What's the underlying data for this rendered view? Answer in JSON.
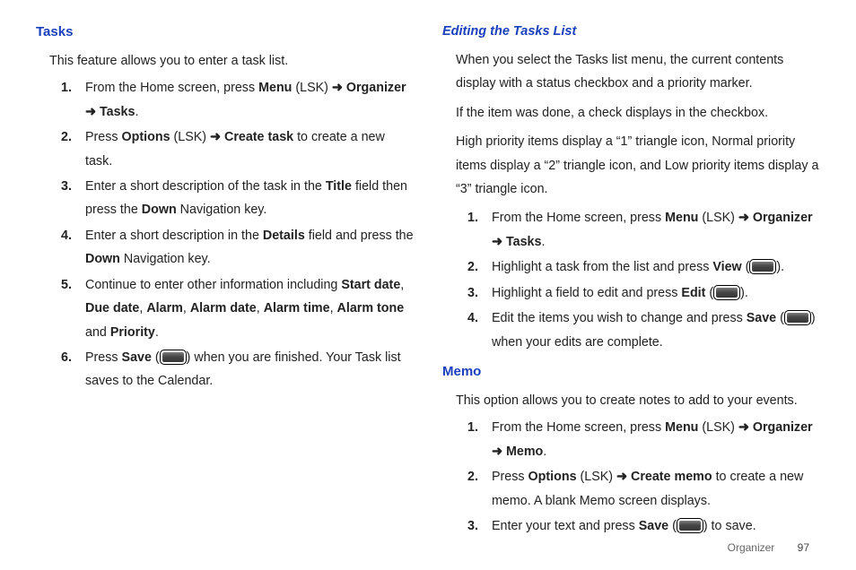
{
  "left": {
    "tasks_heading": "Tasks",
    "tasks_intro": "This feature allows you to enter a task list.",
    "step1_a": "From the Home screen, press ",
    "step1_menu": "Menu",
    "step1_b": " (LSK) ",
    "arrow": "➜",
    "step1_org": " Organizer ",
    "step1_tasks": " Tasks",
    "period": ".",
    "step2_a": "Press ",
    "step2_options": "Options",
    "step2_b": " (LSK) ",
    "step2_create": " Create task",
    "step2_c": " to create a new task.",
    "step3_a": "Enter a short description of the task in the ",
    "step3_title": "Title",
    "step3_b": " field then press the ",
    "step3_down": "Down",
    "step3_c": " Navigation key.",
    "step4_a": "Enter a short description in the ",
    "step4_details": "Details",
    "step4_b": " field and press the ",
    "step4_down": "Down",
    "step4_c": " Navigation key.",
    "step5_a": "Continue to enter other information including ",
    "step5_start": "Start date",
    "step5_sep1": ", ",
    "step5_due": "Due date",
    "step5_sep2": ", ",
    "step5_alarm": "Alarm",
    "step5_sep3": ", ",
    "step5_alarmdate": "Alarm date",
    "step5_sep4": ", ",
    "step5_alarmtime": "Alarm time",
    "step5_sep5": ", ",
    "step5_alarmtone": "Alarm tone",
    "step5_sep6": " and ",
    "step5_priority": "Priority",
    "step6_a": "Press ",
    "step6_save": "Save",
    "step6_b": " (",
    "step6_c": ") when you are finished. Your Task list saves to the Calendar."
  },
  "right": {
    "edit_heading": "Editing the Tasks List",
    "p1": "When you select the Tasks list menu, the current contents display with a status checkbox and a priority marker.",
    "p2": "If the item was done, a check displays in the checkbox.",
    "p3": "High priority items display a “1” triangle icon, Normal priority items display a “2” triangle icon, and Low priority items display a “3” triangle icon.",
    "e1_a": "From the Home screen, press ",
    "e1_menu": "Menu",
    "e1_b": " (LSK) ",
    "e1_org": " Organizer ",
    "e1_tasks": " Tasks",
    "e2_a": "Highlight a task from the list and press ",
    "e2_view": "View",
    "e2_b": " (",
    "e2_c": ").",
    "e3_a": "Highlight a field to edit and press ",
    "e3_edit": "Edit",
    "e3_b": " (",
    "e3_c": ").",
    "e4_a": "Edit the items you wish to change and press ",
    "e4_save": "Save",
    "e4_b": " (",
    "e4_c": ") when your edits are complete.",
    "memo_heading": "Memo",
    "memo_intro": "This option allows you to create notes to add to your events.",
    "m1_a": "From the Home screen, press ",
    "m1_menu": "Menu",
    "m1_b": " (LSK) ",
    "m1_org": " Organizer ",
    "m1_memo": " Memo",
    "m2_a": "Press ",
    "m2_options": "Options",
    "m2_b": " (LSK) ",
    "m2_create": " Create memo",
    "m2_c": " to create a new memo. A blank Memo screen displays.",
    "m3_a": "Enter your text and press ",
    "m3_save": "Save",
    "m3_b": " (",
    "m3_c": ") to save."
  },
  "nums": {
    "n1": "1.",
    "n2": "2.",
    "n3": "3.",
    "n4": "4.",
    "n5": "5.",
    "n6": "6."
  },
  "footer": {
    "section": "Organizer",
    "page": "97"
  }
}
